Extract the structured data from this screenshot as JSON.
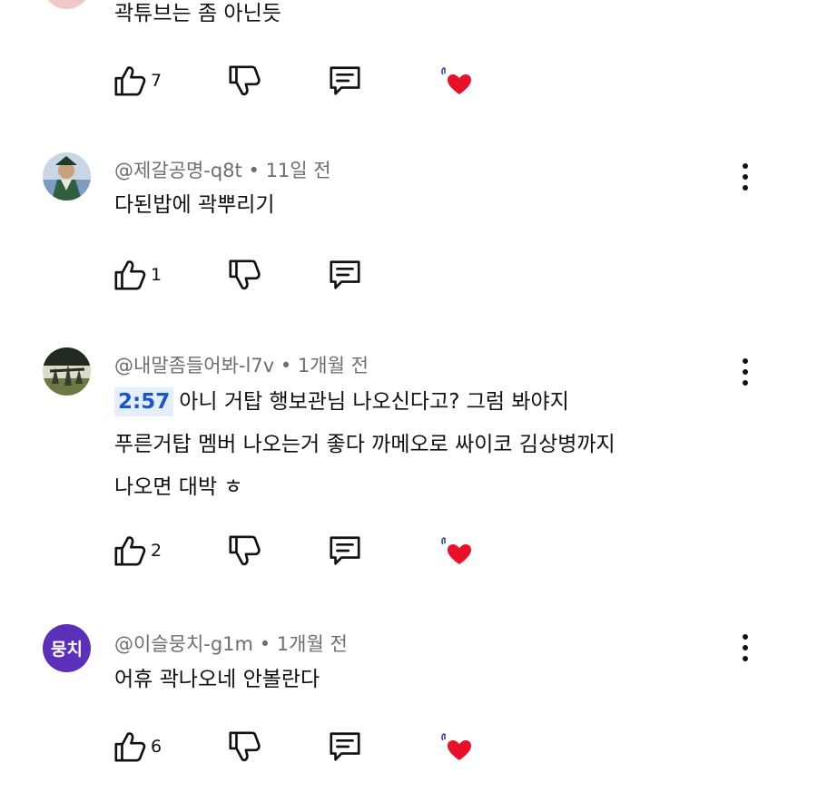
{
  "comments": [
    {
      "author": "",
      "time": "",
      "text": "곽튜브는 좀 아닌듯",
      "likes": "7",
      "creator_hearted": true
    },
    {
      "author": "@제갈공명-q8t",
      "time": "11일 전",
      "text": "다된밥에 곽뿌리기",
      "likes": "1",
      "creator_hearted": false
    },
    {
      "author": "@내말좀들어봐-l7v",
      "time": "1개월 전",
      "timestamp": "2:57",
      "line1": "아니 거탑 행보관님 나오신다고? 그럼 봐야지",
      "line2": "푸른거탑 멤버 나오는거 좋다 까메오로 싸이코 김상병까지",
      "line3": "나오면 대박 ㅎ",
      "likes": "2",
      "creator_hearted": true
    },
    {
      "author": "@이슬뭉치-g1m",
      "avatar_text": "뭉치",
      "avatar_color": "#5b2fb8",
      "time": "1개월 전",
      "text": "어휴 곽나오네 안볼란다",
      "likes": "6",
      "creator_hearted": true
    }
  ],
  "separator": "•",
  "colors": {
    "heart": "#e8102a",
    "timestamp_bg": "#e4eefc",
    "timestamp_fg": "#1a56c8",
    "meta": "#6e6e6e"
  }
}
